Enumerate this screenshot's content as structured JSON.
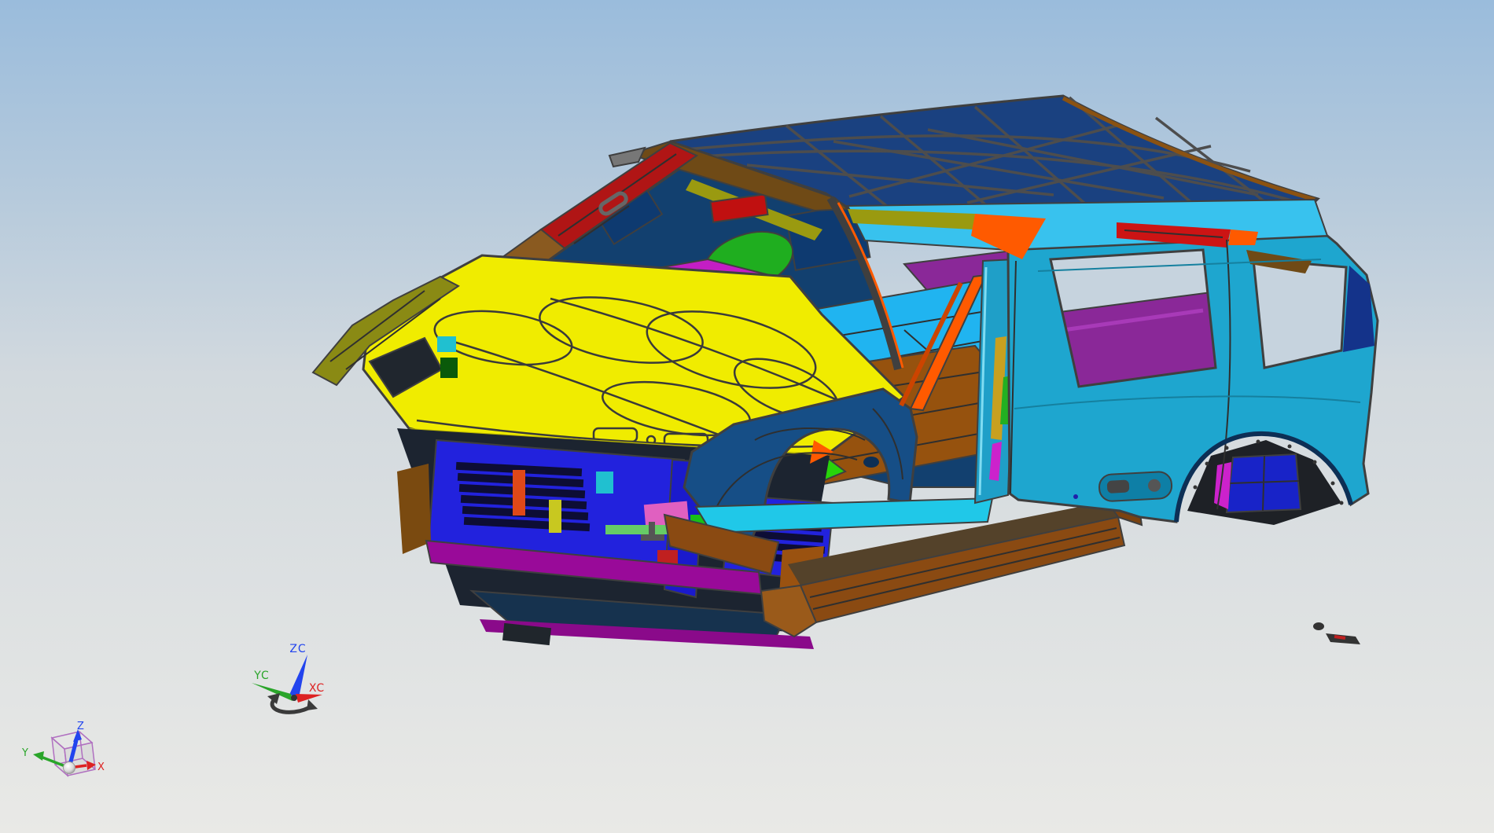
{
  "background": {
    "top": "#9abcdc",
    "upper_mid": "#b4c9dc",
    "lower_mid": "#d2d9de",
    "bottom": "#e9e9e6"
  },
  "labels": {
    "wcs_x": "XC",
    "wcs_y": "YC",
    "wcs_z": "ZC",
    "view_x": "X",
    "view_y": "Y",
    "view_z": "Z"
  },
  "axis_colors": {
    "x": "#dd2222",
    "y": "#2aa52a",
    "z": "#2244ee"
  },
  "colors": {
    "roof": "#1a4180",
    "roof_line": "#4d4d4d",
    "header_brown": "#6f4a16",
    "roof_edge_brown": "#8a5212",
    "trim_olive": "#9a9a10",
    "trim_orange": "#ff5a00",
    "trim_red": "#cc1414",
    "roof_side": "#38c2ee",
    "body": "#1ea6cf",
    "body_dark": "#0e7fa6",
    "window": "#c6d3de",
    "fender": "#164e86",
    "fender_dark": "#0d2f55",
    "hood": "#f0ec00",
    "hood_dark": "#b8b400",
    "fender_tip": "#8a8a14",
    "apillar_red": "#b01515",
    "apillar_brown": "#8a5a20",
    "cowl": "#c41ec4",
    "interior": "#12406f",
    "visor": "#0e3a70",
    "shock_green": "#1fae1f",
    "seat_red": "#c01010",
    "olive_strip": "#9a9a10",
    "panel_purple": "#8a2898",
    "panel_purple2": "#6f1f80",
    "floor_cyan": "#20b4f0",
    "floor_brown": "#96520e",
    "floor_green": "#28d40a",
    "radiator": "#2222dd",
    "slot": "#0d0d35",
    "clip_bg": "#1c2430",
    "bar_magenta": "#990a99",
    "airdam": "#16324e",
    "strip_purple": "#8a0a8a",
    "jp_pink": "#e060c0",
    "jp_green": "#18c018",
    "jp_yellow": "#c8c820",
    "jp_orange": "#e04818",
    "jp_red": "#c02020",
    "jp_cyan": "#20c0d0",
    "corner_brown": "#7a4a10",
    "corner_brown2": "#9a5210",
    "brace": "#ff5a00",
    "pillar_teal": "#1f9fc8",
    "pillar_gold": "#c8a020",
    "sliver_magenta": "#cc22cc",
    "sliver_green": "#22b022",
    "sill_cyan": "#20c8e8",
    "board": "#8a4a12",
    "board_top": "#54422a",
    "board_end": "#9a5a1a",
    "arch_box": "#1823c8",
    "arch_dark": "#1e2126",
    "navy_sliver": "#14338a",
    "handle": "#0e7fa6",
    "debris": "#333333",
    "cube_wire": "#b070c0"
  }
}
